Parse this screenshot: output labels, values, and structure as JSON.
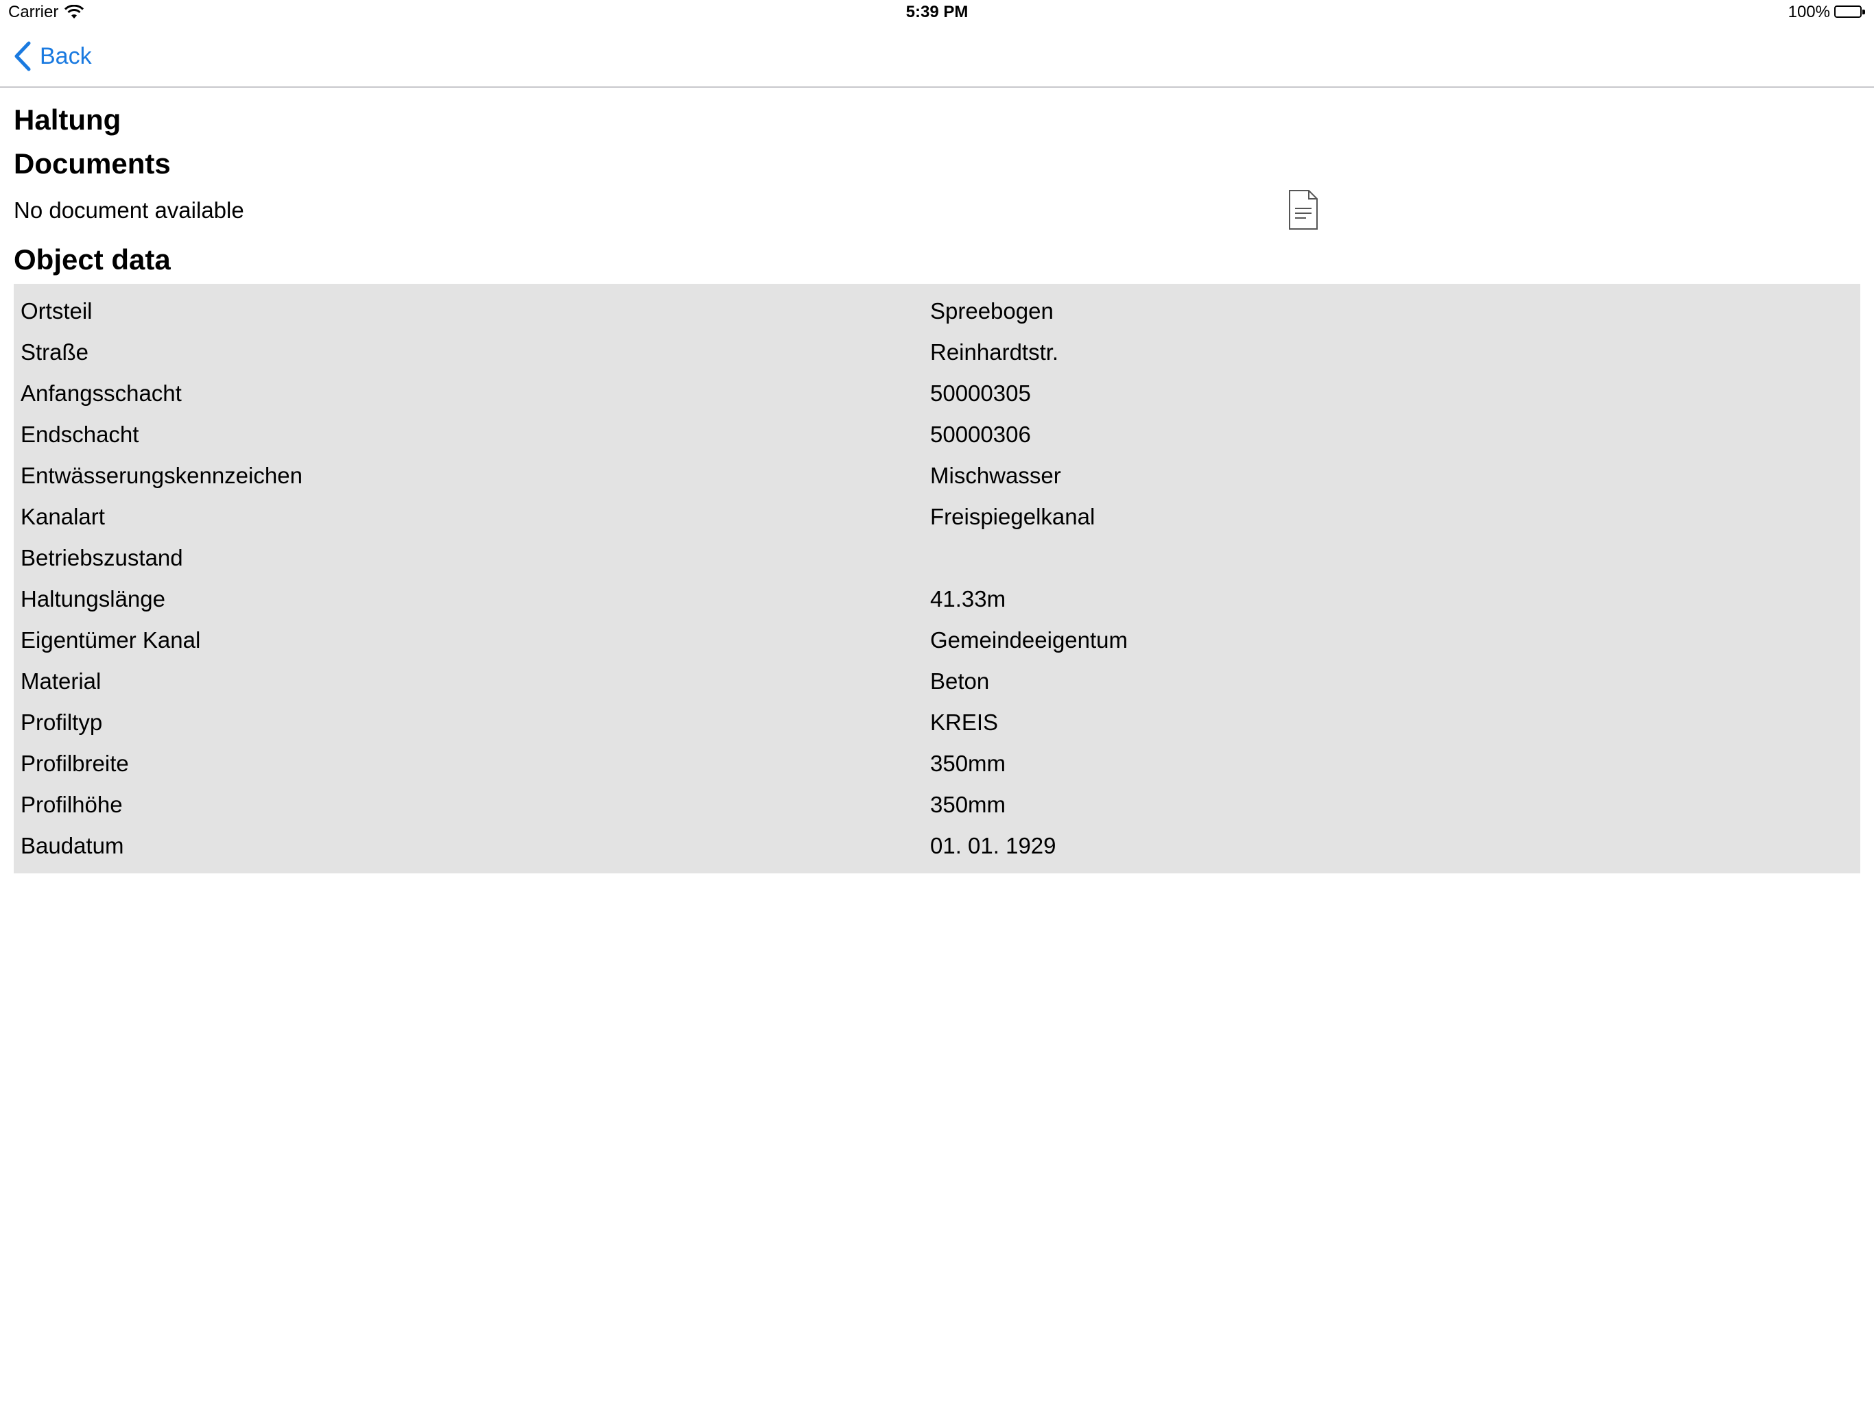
{
  "status_bar": {
    "carrier": "Carrier",
    "time": "5:39 PM",
    "battery": "100%"
  },
  "nav": {
    "back_label": "Back"
  },
  "page": {
    "title": "Haltung",
    "documents_title": "Documents",
    "no_document": "No document available",
    "object_data_title": "Object data"
  },
  "object_data": [
    {
      "key": "Ortsteil",
      "value": "Spreebogen"
    },
    {
      "key": "Straße",
      "value": "Reinhardtstr."
    },
    {
      "key": "Anfangsschacht",
      "value": "50000305"
    },
    {
      "key": "Endschacht",
      "value": "50000306"
    },
    {
      "key": "Entwässerungskennzeichen",
      "value": "Mischwasser"
    },
    {
      "key": "Kanalart",
      "value": "Freispiegelkanal"
    },
    {
      "key": "Betriebszustand",
      "value": ""
    },
    {
      "key": "Haltungslänge",
      "value": "41.33m"
    },
    {
      "key": "Eigentümer Kanal",
      "value": "Gemeindeeigentum"
    },
    {
      "key": "Material",
      "value": "Beton"
    },
    {
      "key": "Profiltyp",
      "value": "KREIS"
    },
    {
      "key": "Profilbreite",
      "value": "350mm"
    },
    {
      "key": "Profilhöhe",
      "value": "350mm"
    },
    {
      "key": "Baudatum",
      "value": "01. 01. 1929"
    }
  ],
  "icons": {
    "wifi": "wifi-icon",
    "battery": "battery-icon",
    "back": "chevron-left-icon",
    "document": "document-icon"
  },
  "colors": {
    "accent": "#1a7ae0",
    "table_background": "#e3e3e3",
    "divider": "#c8c8cc"
  }
}
